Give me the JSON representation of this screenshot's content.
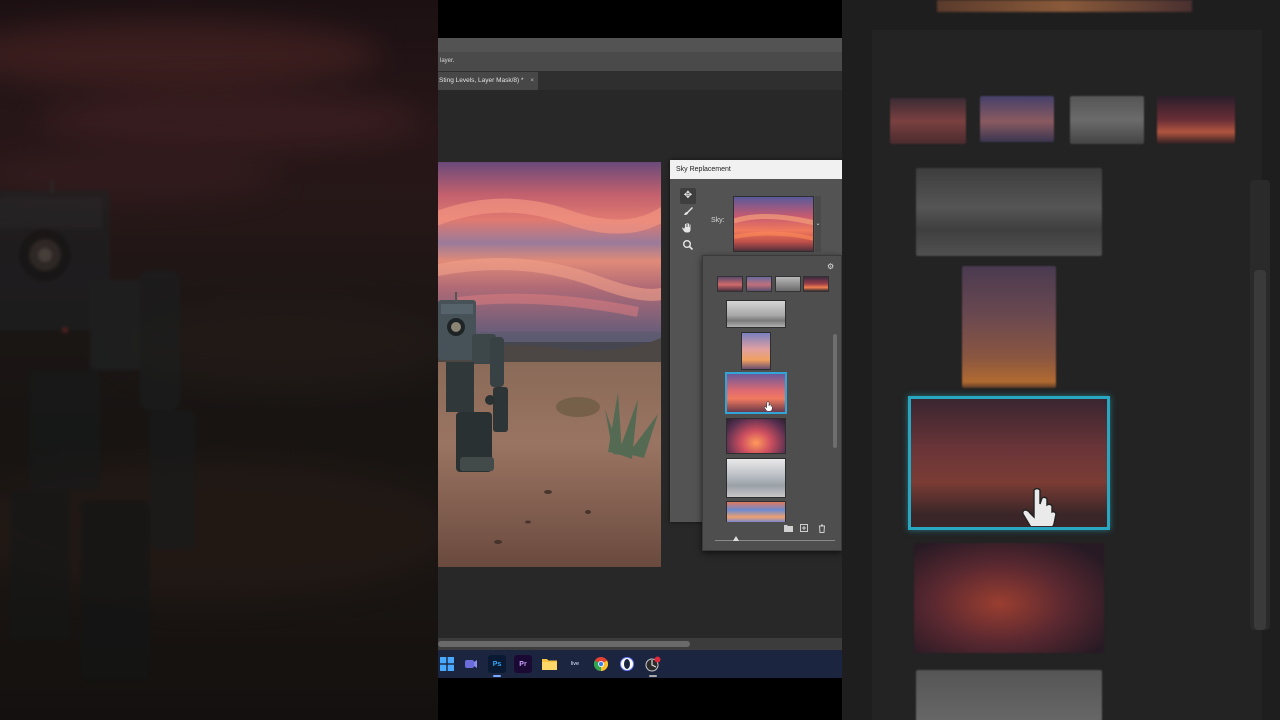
{
  "window": {
    "options_hint": "layer.",
    "tab_title": "Sting Levels, Layer Mask/8) *",
    "tab_close": "×"
  },
  "dialog": {
    "title": "Sky Replacement",
    "sky_label": "Sky:",
    "tools": [
      "move-sky-icon",
      "sky-brush-icon",
      "hand-icon",
      "zoom-icon"
    ],
    "active_tool": "move-sky-icon"
  },
  "picker": {
    "gear_glyph": "⚙",
    "preset_count": 4,
    "thumbnail_count": 6,
    "selected_index": 2,
    "footer_icons": [
      "folder-icon",
      "new-sky-icon",
      "delete-icon"
    ]
  },
  "taskbar": {
    "apps": [
      {
        "name": "windows-start-icon",
        "label": ""
      },
      {
        "name": "teams-icon",
        "label": ""
      },
      {
        "name": "photoshop-icon",
        "label": "Ps"
      },
      {
        "name": "premiere-icon",
        "label": "Pr"
      },
      {
        "name": "file-explorer-icon",
        "label": ""
      },
      {
        "name": "live-app-icon",
        "label": "live"
      },
      {
        "name": "chrome-icon",
        "label": ""
      },
      {
        "name": "opera-icon",
        "label": ""
      },
      {
        "name": "davinci-icon",
        "label": ""
      }
    ],
    "active_app": "photoshop-icon"
  },
  "colors": {
    "selection_accent": "#31a5d8",
    "ps_panel": "#535353",
    "ps_canvas": "#282828",
    "taskbar": "#1b2540"
  }
}
